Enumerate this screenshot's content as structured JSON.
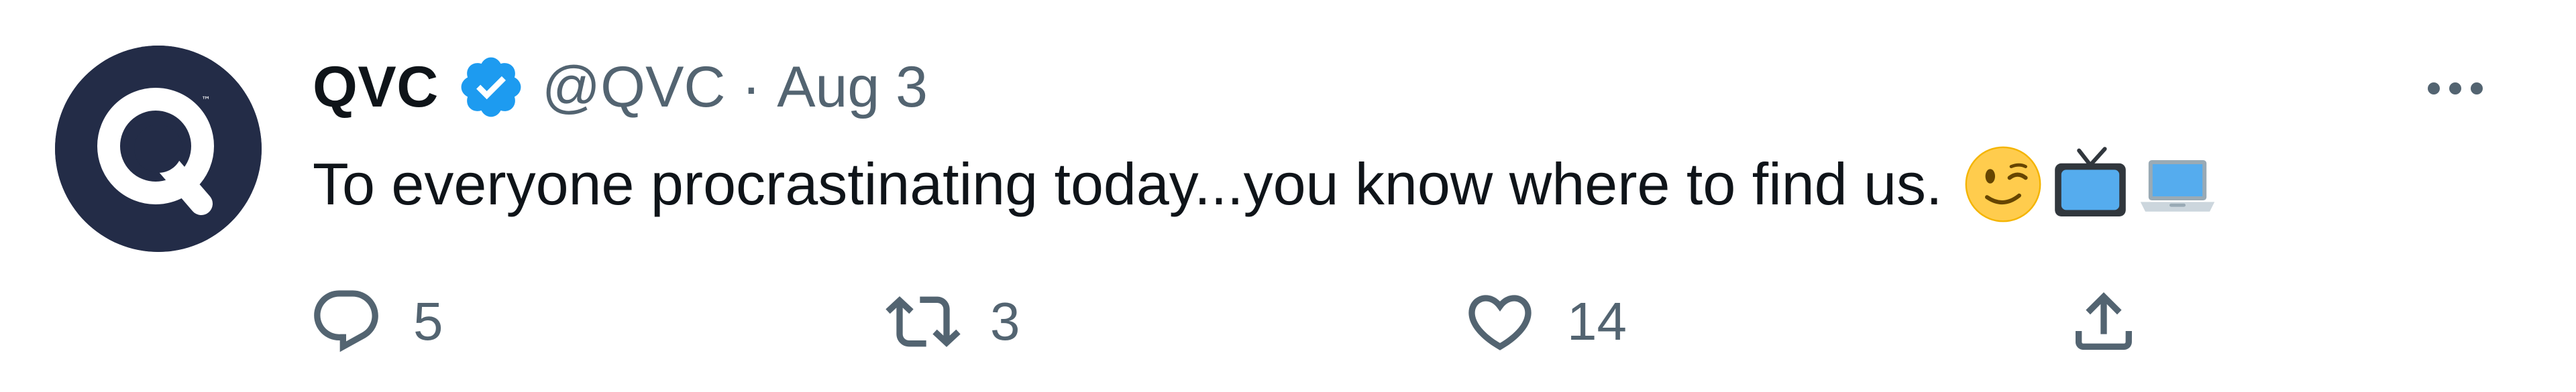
{
  "tweet": {
    "author_name": "QVC",
    "handle": "@QVC",
    "separator": "·",
    "date": "Aug 3",
    "text": "To everyone procrastinating today...you know where to find us.",
    "emojis": [
      "winking-face",
      "television",
      "laptop"
    ],
    "avatar_letter": "Q"
  },
  "actions": {
    "reply_count": "5",
    "retweet_count": "3",
    "like_count": "14"
  },
  "colors": {
    "avatar_bg": "#232c47",
    "verified": "#1d9bf0",
    "secondary_text": "#536471",
    "primary_text": "#0f1419"
  }
}
